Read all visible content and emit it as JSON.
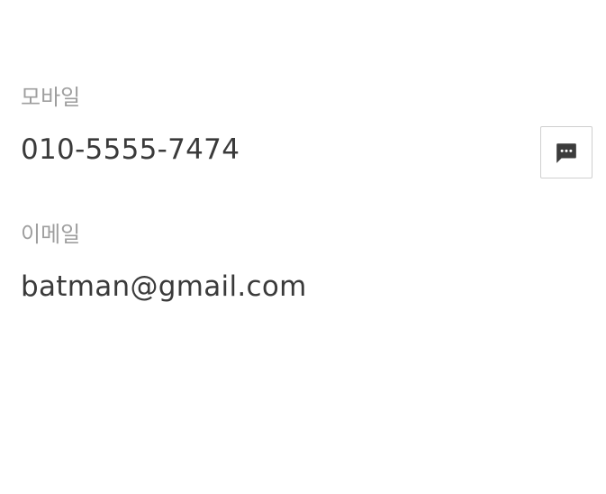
{
  "mobile": {
    "label": "모바일",
    "value": "010-5555-7474",
    "message_icon": "message-icon"
  },
  "email": {
    "label": "이메일",
    "value": "batman@gmail.com"
  },
  "colors": {
    "label": "#9e9e9e",
    "value": "#3a3a3a",
    "icon": "#3c3c3c",
    "button_border": "#cfcfcf"
  }
}
